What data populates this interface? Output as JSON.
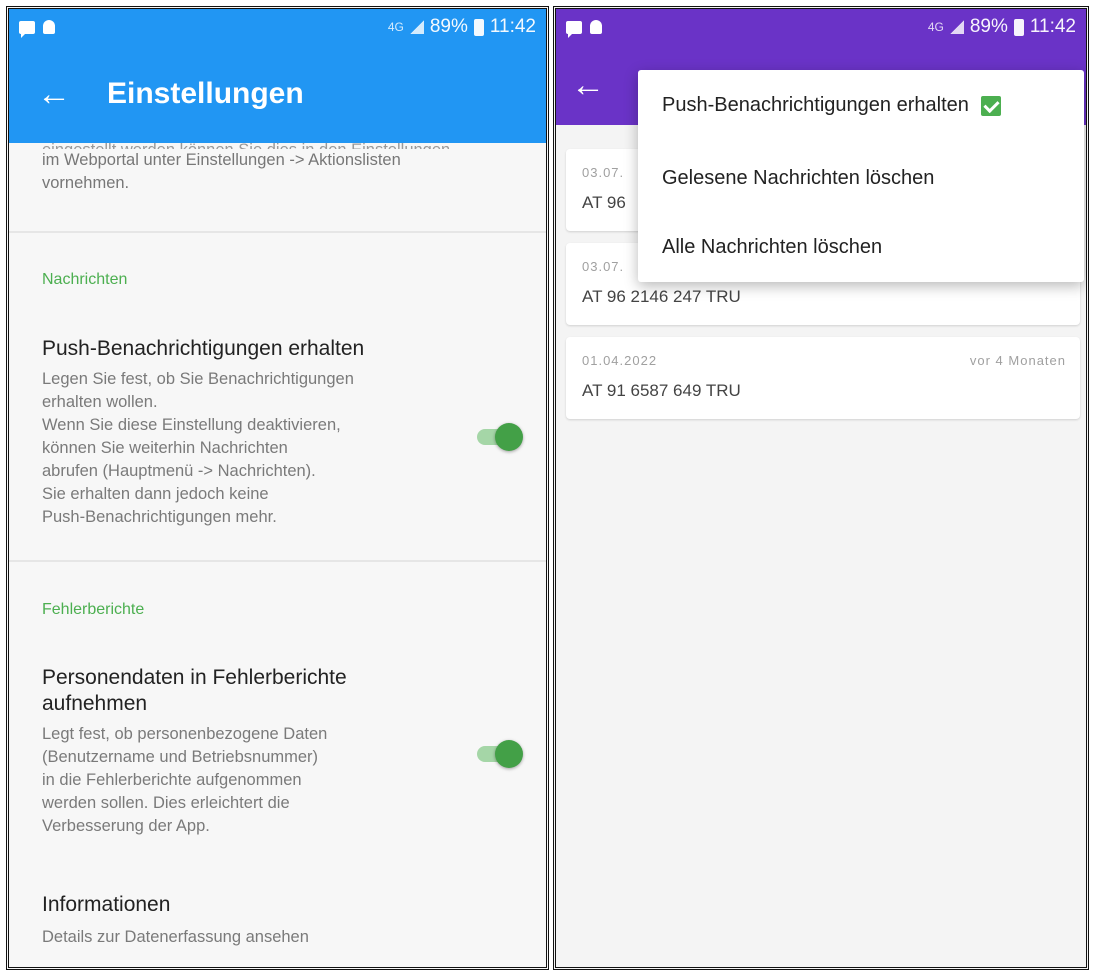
{
  "status_bar": {
    "battery": "89%",
    "time": "11:42",
    "network_badge": "4G"
  },
  "left_screen": {
    "title": "Einstellungen",
    "truncated_text_line": "eingestellt werden können Sie dies in den Einstellungen",
    "intro_text": "im Webportal unter Einstellungen -> Aktionslisten\nvornehmen.",
    "sections": {
      "nachrichten": {
        "header": "Nachrichten",
        "push_title": "Push-Benachrichtigungen erhalten",
        "push_summary": "Legen Sie fest, ob Sie Benachrichtigungen\nerhalten wollen.\nWenn Sie diese Einstellung deaktivieren,\nkönnen Sie weiterhin Nachrichten\nabrufen (Hauptmenü -> Nachrichten).\nSie erhalten dann jedoch keine\nPush-Benachrichtigungen mehr.",
        "push_enabled": true
      },
      "fehlerberichte": {
        "header": "Fehlerberichte",
        "personendaten_title": "Personendaten in Fehlerberichte\naufnehmen",
        "personendaten_summary": "Legt fest, ob personenbezogene Daten\n(Benutzername und Betriebsnummer)\nin die Fehlerberichte aufgenommen\nwerden sollen. Dies erleichtert die\nVerbesserung der App.",
        "personendaten_enabled": true,
        "info_title": "Informationen",
        "info_summary": "Details zur Datenerfassung ansehen"
      }
    }
  },
  "right_screen": {
    "messages": [
      {
        "date": "03.07.",
        "body": "AT 96",
        "ago": ""
      },
      {
        "date": "03.07.",
        "body": "AT 96 2146 247 TRU",
        "ago": ""
      },
      {
        "date": "01.04.2022",
        "body": "AT 91 6587 649 TRU",
        "ago": "vor 4 Monaten"
      }
    ],
    "menu": {
      "push": "Push-Benachrichtigungen erhalten",
      "push_checked": true,
      "delete_read": "Gelesene Nachrichten löschen",
      "delete_all": "Alle Nachrichten löschen"
    }
  },
  "colors": {
    "left_app_bar": "#2196f3",
    "right_app_bar": "#6a33c7",
    "accent_green": "#4caf50"
  },
  "icons": [
    "chat-icon",
    "notification-icon",
    "signal-icon",
    "battery-icon",
    "back-arrow-icon",
    "checkbox-checked-icon"
  ]
}
